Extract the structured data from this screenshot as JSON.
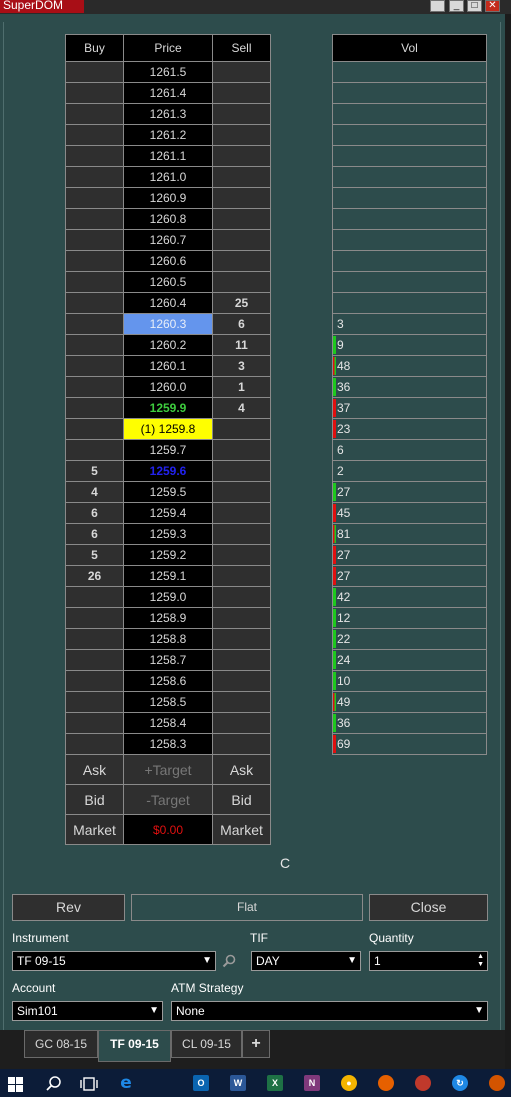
{
  "window": {
    "title": "SuperDOM",
    "minimize": "_",
    "maximize": "□",
    "close": "✕"
  },
  "headers": {
    "buy": "Buy",
    "price": "Price",
    "sell": "Sell",
    "vol": "Vol"
  },
  "ladder": [
    {
      "price": "1261.5",
      "buy": "",
      "sell": ""
    },
    {
      "price": "1261.4",
      "buy": "",
      "sell": ""
    },
    {
      "price": "1261.3",
      "buy": "",
      "sell": ""
    },
    {
      "price": "1261.2",
      "buy": "",
      "sell": ""
    },
    {
      "price": "1261.1",
      "buy": "",
      "sell": ""
    },
    {
      "price": "1261.0",
      "buy": "",
      "sell": ""
    },
    {
      "price": "1260.9",
      "buy": "",
      "sell": ""
    },
    {
      "price": "1260.8",
      "buy": "",
      "sell": ""
    },
    {
      "price": "1260.7",
      "buy": "",
      "sell": ""
    },
    {
      "price": "1260.6",
      "buy": "",
      "sell": ""
    },
    {
      "price": "1260.5",
      "buy": "",
      "sell": ""
    },
    {
      "price": "1260.4",
      "buy": "",
      "sell": "25"
    },
    {
      "price": "1260.3",
      "buy": "",
      "sell": "6",
      "state": "ask"
    },
    {
      "price": "1260.2",
      "buy": "",
      "sell": "11"
    },
    {
      "price": "1260.1",
      "buy": "",
      "sell": "3"
    },
    {
      "price": "1260.0",
      "buy": "",
      "sell": "1"
    },
    {
      "price": "1259.9",
      "buy": "",
      "sell": "4",
      "state": "last"
    },
    {
      "price": "(1) 1259.8",
      "buy": "",
      "sell": "",
      "state": "bid"
    },
    {
      "price": "1259.7",
      "buy": "",
      "sell": ""
    },
    {
      "price": "1259.6",
      "buy": "5",
      "sell": "",
      "state": "prev"
    },
    {
      "price": "1259.5",
      "buy": "4",
      "sell": ""
    },
    {
      "price": "1259.4",
      "buy": "6",
      "sell": ""
    },
    {
      "price": "1259.3",
      "buy": "6",
      "sell": ""
    },
    {
      "price": "1259.2",
      "buy": "5",
      "sell": ""
    },
    {
      "price": "1259.1",
      "buy": "26",
      "sell": ""
    },
    {
      "price": "1259.0",
      "buy": "",
      "sell": ""
    },
    {
      "price": "1258.9",
      "buy": "",
      "sell": ""
    },
    {
      "price": "1258.8",
      "buy": "",
      "sell": ""
    },
    {
      "price": "1258.7",
      "buy": "",
      "sell": ""
    },
    {
      "price": "1258.6",
      "buy": "",
      "sell": ""
    },
    {
      "price": "1258.5",
      "buy": "",
      "sell": ""
    },
    {
      "price": "1258.4",
      "buy": "",
      "sell": ""
    },
    {
      "price": "1258.3",
      "buy": "",
      "sell": ""
    }
  ],
  "volume": [
    {
      "value": "",
      "bar": "none"
    },
    {
      "value": "",
      "bar": "none"
    },
    {
      "value": "",
      "bar": "none"
    },
    {
      "value": "",
      "bar": "none"
    },
    {
      "value": "",
      "bar": "none"
    },
    {
      "value": "",
      "bar": "none"
    },
    {
      "value": "",
      "bar": "none"
    },
    {
      "value": "",
      "bar": "none"
    },
    {
      "value": "",
      "bar": "none"
    },
    {
      "value": "",
      "bar": "none"
    },
    {
      "value": "",
      "bar": "none"
    },
    {
      "value": "",
      "bar": "none"
    },
    {
      "value": "3",
      "bar": "none"
    },
    {
      "value": "9",
      "bar": "green"
    },
    {
      "value": "48",
      "bar": "mixed"
    },
    {
      "value": "36",
      "bar": "green"
    },
    {
      "value": "37",
      "bar": "red"
    },
    {
      "value": "23",
      "bar": "red"
    },
    {
      "value": "6",
      "bar": "none"
    },
    {
      "value": "2",
      "bar": "none"
    },
    {
      "value": "27",
      "bar": "green"
    },
    {
      "value": "45",
      "bar": "red"
    },
    {
      "value": "81",
      "bar": "mixed"
    },
    {
      "value": "27",
      "bar": "red"
    },
    {
      "value": "27",
      "bar": "red"
    },
    {
      "value": "42",
      "bar": "green"
    },
    {
      "value": "12",
      "bar": "green"
    },
    {
      "value": "22",
      "bar": "green"
    },
    {
      "value": "24",
      "bar": "green"
    },
    {
      "value": "10",
      "bar": "green"
    },
    {
      "value": "49",
      "bar": "mixed"
    },
    {
      "value": "36",
      "bar": "green"
    },
    {
      "value": "69",
      "bar": "red"
    }
  ],
  "controls": {
    "ask_buy": "Ask",
    "target_plus": "+Target",
    "ask_sell": "Ask",
    "bid_buy": "Bid",
    "target_minus": "-Target",
    "bid_sell": "Bid",
    "market_buy": "Market",
    "pnl": "$0.00",
    "market_sell": "Market",
    "c_label": "C"
  },
  "buttons": {
    "rev": "Rev",
    "flat": "Flat",
    "close": "Close"
  },
  "form": {
    "instrument_label": "Instrument",
    "instrument_value": "TF 09-15",
    "tif_label": "TIF",
    "tif_value": "DAY",
    "quantity_label": "Quantity",
    "quantity_value": "1",
    "account_label": "Account",
    "account_value": "Sim101",
    "atm_label": "ATM Strategy",
    "atm_value": "None"
  },
  "tabs": [
    "GC 08-15",
    "TF 09-15",
    "CL 09-15",
    "+"
  ],
  "taskbar_icons": [
    "start-icon",
    "search-icon",
    "task-view-icon",
    "edge-icon",
    "outlook-icon",
    "word-icon",
    "excel-icon",
    "onenote-icon",
    "chrome-icon",
    "firefox-icon",
    "app-icon",
    "app2-icon",
    "app3-icon"
  ],
  "colors": {
    "panel": "#2d4c4c",
    "ask": "#6495ed",
    "bid": "#ffff00",
    "pnl": "#e01010",
    "last": "#3ecd3e",
    "title": "#a80e16"
  }
}
